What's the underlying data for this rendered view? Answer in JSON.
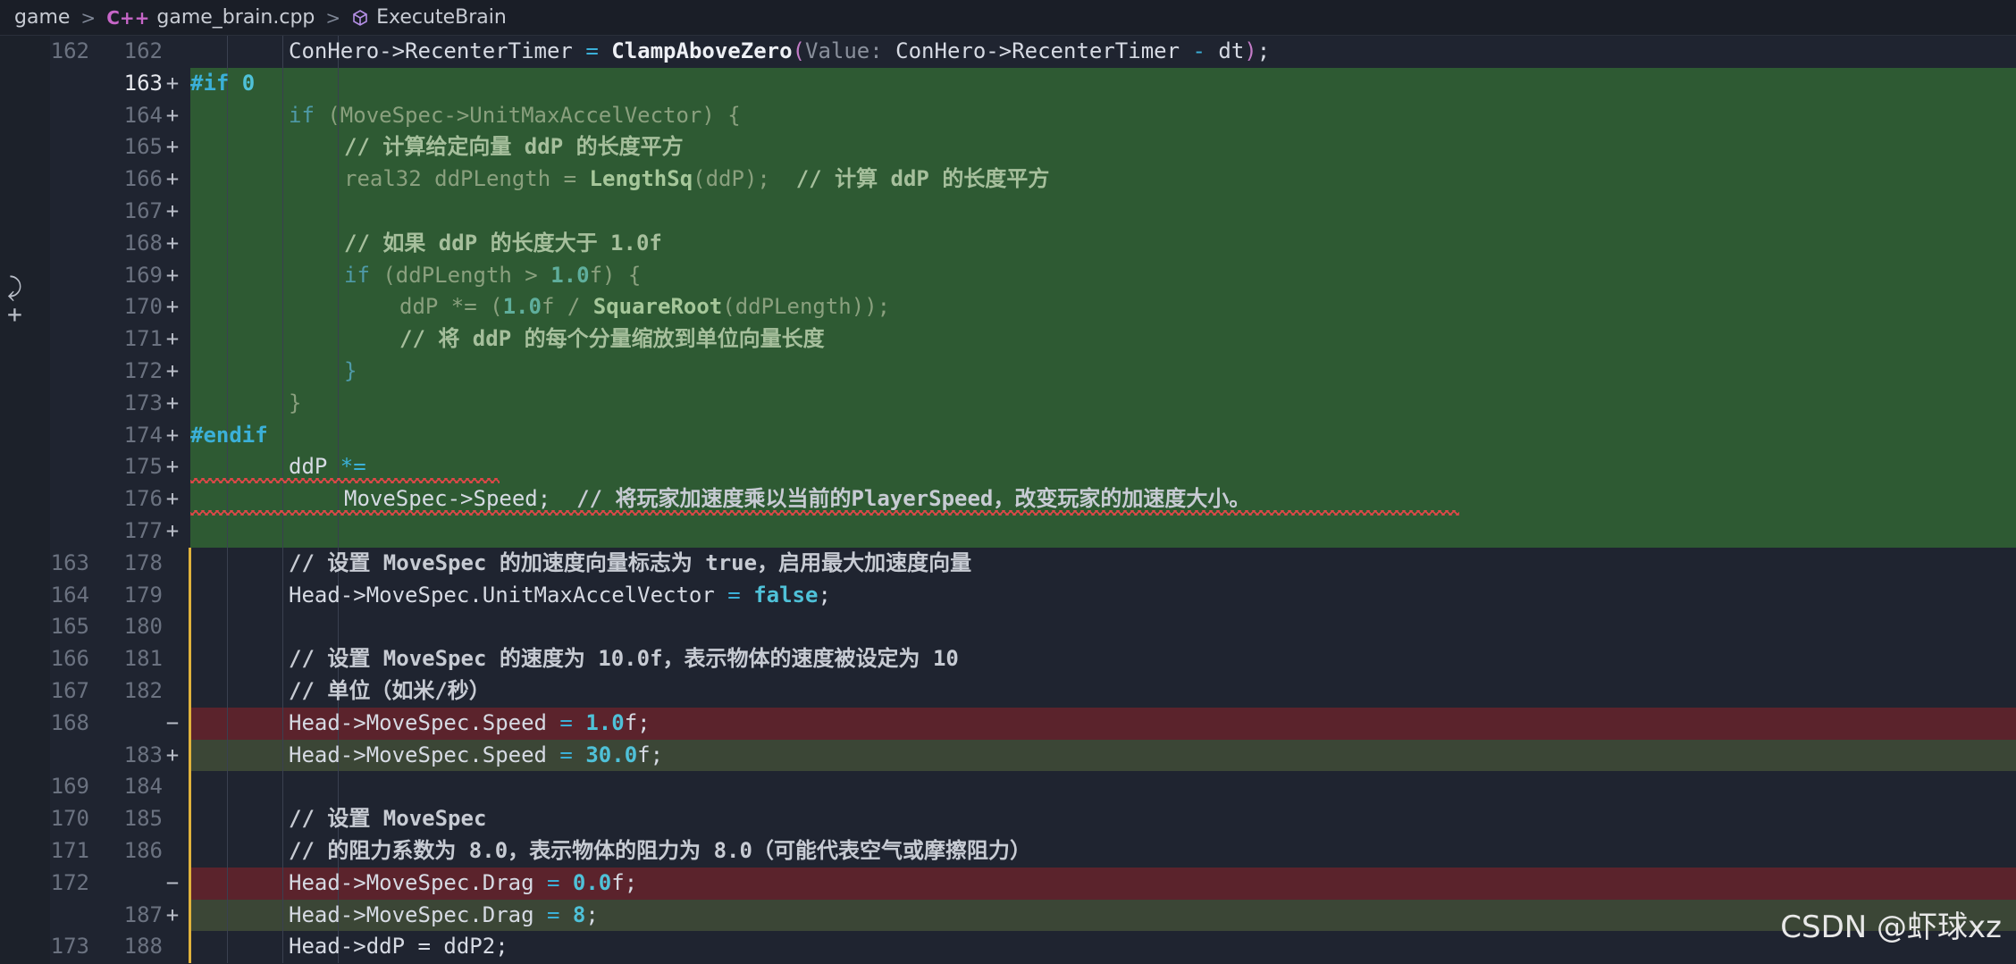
{
  "breadcrumb": {
    "root": "game",
    "file": "game_brain.cpp",
    "file_icon": "C++",
    "symbol": "ExecuteBrain"
  },
  "lines": [
    {
      "old": "162",
      "new": "162",
      "mark": "",
      "type": "ctx"
    },
    {
      "old": "",
      "new": "163",
      "mark": "+",
      "type": "added"
    },
    {
      "old": "",
      "new": "164",
      "mark": "+",
      "type": "added"
    },
    {
      "old": "",
      "new": "165",
      "mark": "+",
      "type": "added"
    },
    {
      "old": "",
      "new": "166",
      "mark": "+",
      "type": "added"
    },
    {
      "old": "",
      "new": "167",
      "mark": "+",
      "type": "added"
    },
    {
      "old": "",
      "new": "168",
      "mark": "+",
      "type": "added"
    },
    {
      "old": "",
      "new": "169",
      "mark": "+",
      "type": "added"
    },
    {
      "old": "",
      "new": "170",
      "mark": "+",
      "type": "added"
    },
    {
      "old": "",
      "new": "171",
      "mark": "+",
      "type": "added"
    },
    {
      "old": "",
      "new": "172",
      "mark": "+",
      "type": "added"
    },
    {
      "old": "",
      "new": "173",
      "mark": "+",
      "type": "added"
    },
    {
      "old": "",
      "new": "174",
      "mark": "+",
      "type": "added"
    },
    {
      "old": "",
      "new": "175",
      "mark": "+",
      "type": "added"
    },
    {
      "old": "",
      "new": "176",
      "mark": "+",
      "type": "added"
    },
    {
      "old": "",
      "new": "177",
      "mark": "+",
      "type": "added"
    },
    {
      "old": "163",
      "new": "178",
      "mark": "",
      "type": "ctx"
    },
    {
      "old": "164",
      "new": "179",
      "mark": "",
      "type": "ctx"
    },
    {
      "old": "165",
      "new": "180",
      "mark": "",
      "type": "ctx"
    },
    {
      "old": "166",
      "new": "181",
      "mark": "",
      "type": "ctx"
    },
    {
      "old": "167",
      "new": "182",
      "mark": "",
      "type": "ctx"
    },
    {
      "old": "168",
      "new": "",
      "mark": "−",
      "type": "removed"
    },
    {
      "old": "",
      "new": "183",
      "mark": "+",
      "type": "changed"
    },
    {
      "old": "169",
      "new": "184",
      "mark": "",
      "type": "ctx"
    },
    {
      "old": "170",
      "new": "185",
      "mark": "",
      "type": "ctx"
    },
    {
      "old": "171",
      "new": "186",
      "mark": "",
      "type": "ctx"
    },
    {
      "old": "172",
      "new": "",
      "mark": "−",
      "type": "removed"
    },
    {
      "old": "",
      "new": "187",
      "mark": "+",
      "type": "changed"
    },
    {
      "old": "173",
      "new": "188",
      "mark": "",
      "type": "ctx"
    }
  ],
  "code": {
    "l162_a": "ConHero->RecenterTimer",
    "l162_eq": " = ",
    "l162_fn": "ClampAboveZero",
    "l162_hint": "Value:",
    "l162_arg": " ConHero->RecenterTimer ",
    "l162_minus": "-",
    "l162_dt": " dt",
    "l162_end": ";",
    "l163_pp": "#if ",
    "l163_num": "0",
    "l164_kw": "if",
    "l164_txt": " (MoveSpec->UnitMaxAccelVector) {",
    "l165_cm": "// 计算给定向量 ddP 的长度平方",
    "l166_a": "real32 ddPLength = ",
    "l166_fn": "LengthSq",
    "l166_b": "(ddP);  ",
    "l166_cm": "// 计算 ddP 的长度平方",
    "l168_cm": "// 如果 ddP 的长度大于 1.0f",
    "l169_kw": "if",
    "l169_a": " (ddPLength > ",
    "l169_num": "1.0",
    "l169_b": "f) {",
    "l170_a": "ddP *= (",
    "l170_num": "1.0",
    "l170_b": "f / ",
    "l170_fn": "SquareRoot",
    "l170_c": "(ddPLength));",
    "l171_cm": "// 将 ddP 的每个分量缩放到单位向量长度",
    "l172": "}",
    "l173": "}",
    "l174_pp": "#endif",
    "l175_a": "ddP ",
    "l175_op": "*=",
    "l176_a": "MoveSpec->Speed;  ",
    "l176_cm": "// 将玩家加速度乘以当前的PlayerSpeed，改变玩家的加速度大小。",
    "l178_cm": "// 设置 MoveSpec 的加速度向量标志为 true，启用最大加速度向量",
    "l179_a": "Head->MoveSpec.UnitMaxAccelVector",
    "l179_eq": " = ",
    "l179_kw": "false",
    "l179_end": ";",
    "l181_cm": "// 设置 MoveSpec 的速度为 10.0f，表示物体的速度被设定为 10",
    "l182_cm": "// 单位（如米/秒）",
    "l168r_a": "Head->MoveSpec.Speed",
    "l168r_eq": " = ",
    "l168r_num": "1.0",
    "l168r_b": "f;",
    "l183_a": "Head->MoveSpec.Speed",
    "l183_eq": " = ",
    "l183_num": "30.0",
    "l183_b": "f;",
    "l185_cm": "// 设置 MoveSpec",
    "l186_cm": "// 的阻力系数为 8.0，表示物体的阻力为 8.0（可能代表空气或摩擦阻力）",
    "l172r_a": "Head->MoveSpec.Drag",
    "l172r_eq": " = ",
    "l172r_num": "0.0",
    "l172r_b": "f;",
    "l187_a": "Head->MoveSpec.Drag",
    "l187_eq": " = ",
    "l187_num": "8",
    "l187_b": ";",
    "l188_a": "Head->ddP = ddP2;"
  },
  "watermark": "CSDN @虾球xz"
}
